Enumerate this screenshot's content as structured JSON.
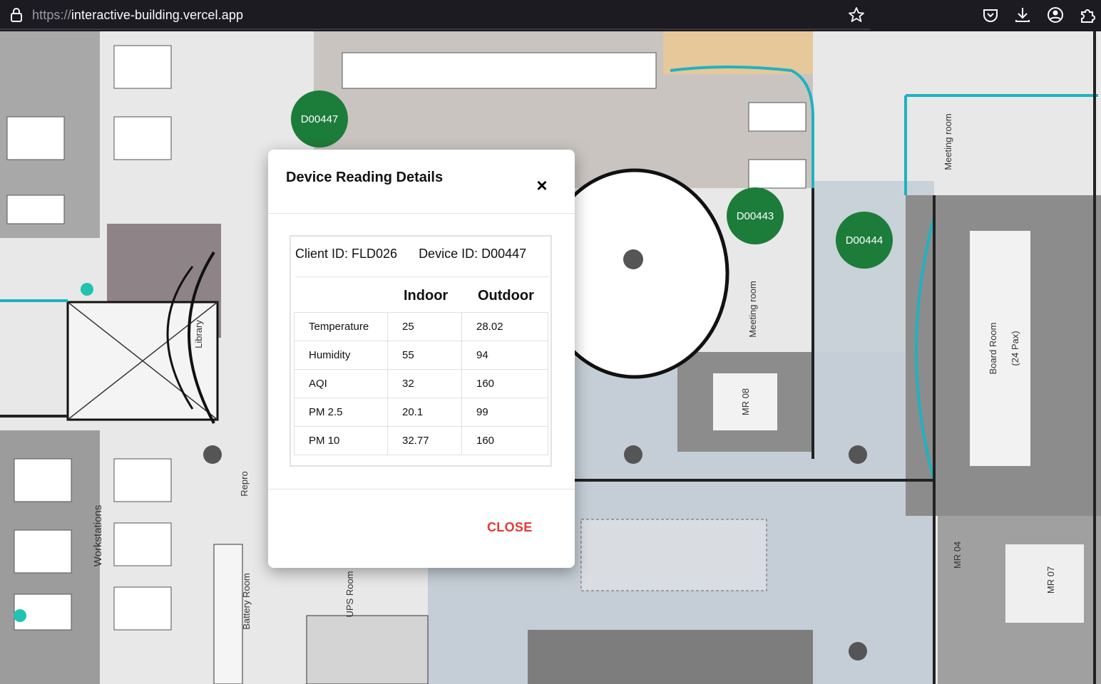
{
  "browser": {
    "url_protocol": "https://",
    "url_host": "interactive-building.vercel.app"
  },
  "markers": [
    {
      "id": "D00447"
    },
    {
      "id": "D00443"
    },
    {
      "id": "D00444"
    }
  ],
  "modal": {
    "title": "Device Reading Details",
    "close_icon": "×",
    "client_label": "Client ID: FLD026",
    "device_label": "Device ID: D00447",
    "headers": {
      "indoor": "Indoor",
      "outdoor": "Outdoor"
    },
    "rows": [
      {
        "label": "Temperature",
        "indoor": "25",
        "outdoor": "28.02"
      },
      {
        "label": "Humidity",
        "indoor": "55",
        "outdoor": "94"
      },
      {
        "label": "AQI",
        "indoor": "32",
        "outdoor": "160"
      },
      {
        "label": "PM 2.5",
        "indoor": "20.1",
        "outdoor": "99"
      },
      {
        "label": "PM 10",
        "indoor": "32.77",
        "outdoor": "160"
      }
    ],
    "close_label": "CLOSE"
  },
  "plan_labels": {
    "library": "Library",
    "workstations": "Workstations",
    "repro": "Repro",
    "battery_room": "Battery Room",
    "ups_room": "UPS Room",
    "meeting_room_1": "Meeting room",
    "meeting_room_2": "Meeting room",
    "board_room": "Board Room",
    "board_room_pax": "(24 Pax)",
    "mr_08": "MR 08",
    "mr_04": "MR 04",
    "mr_07": "MR 07"
  },
  "colors": {
    "marker_green": "#1c7c3a",
    "close_red": "#e53935",
    "wall_teal": "#1fb2c0"
  }
}
